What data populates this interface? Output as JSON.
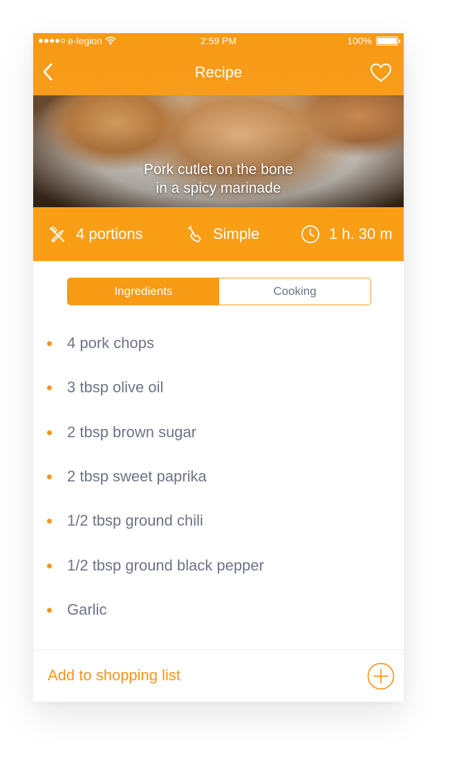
{
  "status_bar": {
    "carrier": "e-legion",
    "time": "2:59 PM",
    "battery": "100%"
  },
  "nav": {
    "title": "Recipe",
    "back_icon": "chevron-left-icon",
    "favorite_icon": "heart-icon"
  },
  "hero": {
    "title_line1": "Pork cutlet on the bone",
    "title_line2": "in a spicy marinade"
  },
  "info": {
    "portions": "4 portions",
    "difficulty": "Simple",
    "time": "1 h. 30 m"
  },
  "tabs": {
    "ingredients": "Ingredients",
    "cooking": "Cooking",
    "selected": "Ingredients"
  },
  "ingredients": [
    "4 pork chops",
    "3 tbsp olive oil",
    "2 tbsp brown sugar",
    "2 tbsp sweet paprika",
    "1/2 tbsp ground chili",
    "1/2 tbsp ground black pepper",
    "Garlic"
  ],
  "footer": {
    "add_label": "Add to shopping list",
    "add_icon": "plus-circle-icon"
  },
  "colors": {
    "accent": "#F7941D",
    "header": "#F99C1B",
    "text_muted": "#6D7386"
  }
}
